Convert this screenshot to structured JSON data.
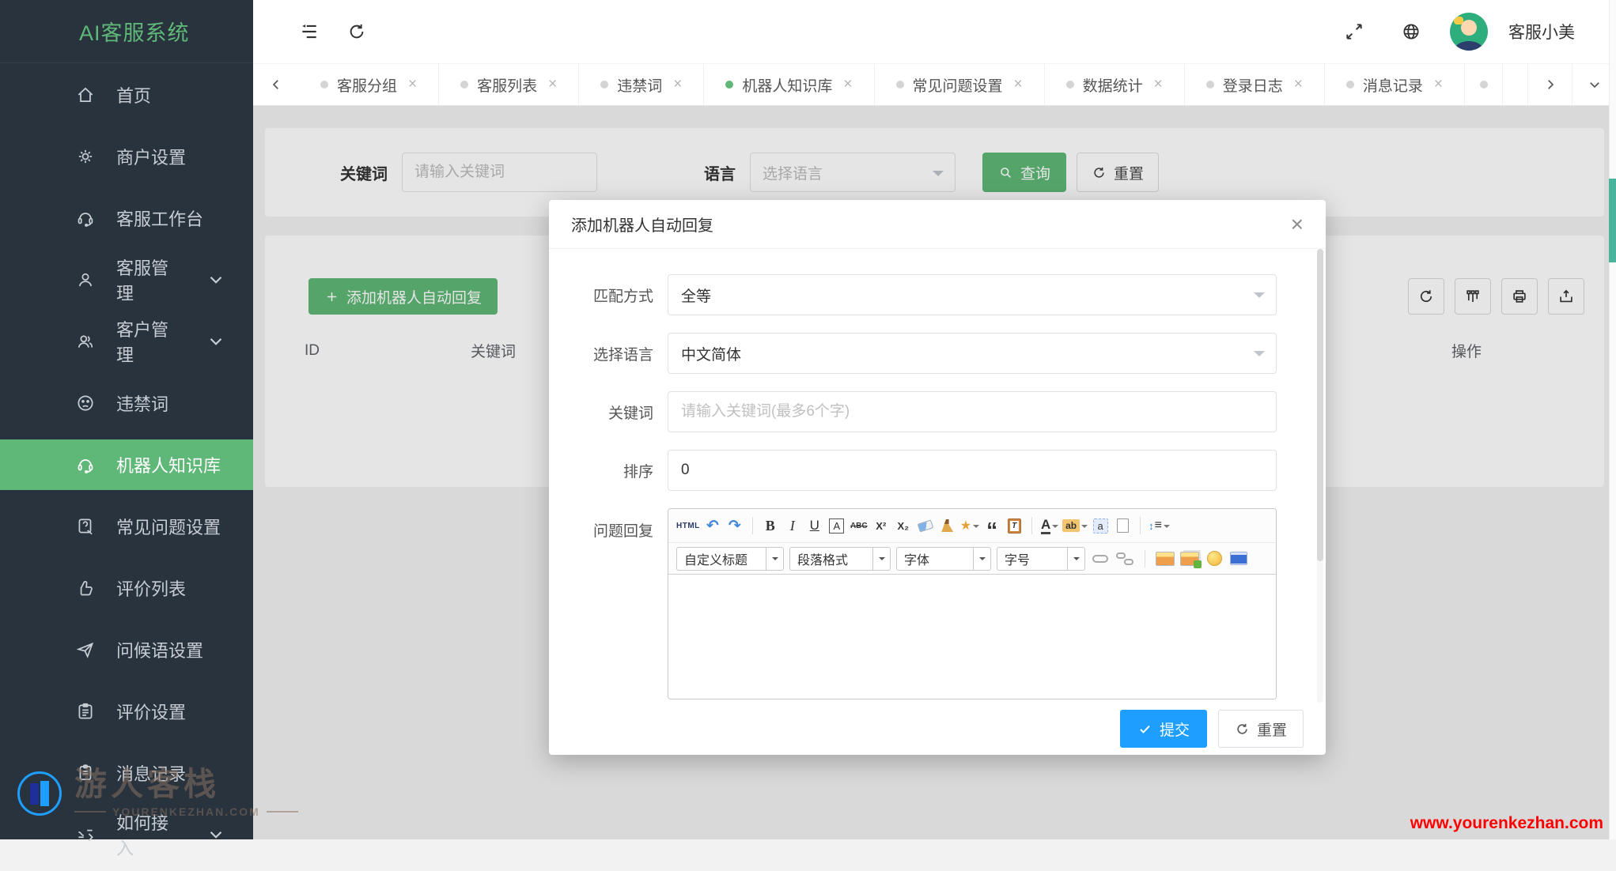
{
  "app": {
    "title": "AI客服系统",
    "user_name": "客服小美"
  },
  "sidebar": {
    "items": [
      {
        "label": "首页"
      },
      {
        "label": "商户设置"
      },
      {
        "label": "客服工作台"
      },
      {
        "label": "客服管理"
      },
      {
        "label": "客户管理"
      },
      {
        "label": "违禁词"
      },
      {
        "label": "机器人知识库"
      },
      {
        "label": "常见问题设置"
      },
      {
        "label": "评价列表"
      },
      {
        "label": "问候语设置"
      },
      {
        "label": "评价设置"
      },
      {
        "label": "消息记录"
      },
      {
        "label": "如何接入"
      }
    ],
    "watermark": {
      "name": "游人客栈",
      "domain": "YOURENKEZHAN.COM"
    }
  },
  "tabs": [
    "客服分组",
    "客服列表",
    "违禁词",
    "机器人知识库",
    "常见问题设置",
    "数据统计",
    "登录日志",
    "消息记录"
  ],
  "filter": {
    "keyword_label": "关键词",
    "keyword_placeholder": "请输入关键词",
    "language_label": "语言",
    "language_placeholder": "选择语言",
    "search_button": "查询",
    "reset_button": "重置"
  },
  "list": {
    "add_button": "添加机器人自动回复",
    "columns": {
      "id": "ID",
      "keyword": "关键词",
      "action": "操作"
    }
  },
  "modal": {
    "title": "添加机器人自动回复",
    "match_label": "匹配方式",
    "match_value": "全等",
    "language_label": "选择语言",
    "language_value": "中文简体",
    "keyword_label": "关键词",
    "keyword_placeholder": "请输入关键词(最多6个字)",
    "sort_label": "排序",
    "sort_value": "0",
    "reply_label": "问题回复",
    "editor": {
      "selects": [
        "自定义标题",
        "段落格式",
        "字体",
        "字号"
      ],
      "glyphs": {
        "html": "HTML",
        "undo": "↶",
        "redo": "↷",
        "bold": "B",
        "italic": "I",
        "underline": "U",
        "font_border": "A",
        "strikethrough": "ABC",
        "superscript": "X²",
        "subscript": "X₂",
        "wand": "★",
        "quote": "“",
        "paste_t": "T",
        "font_color": "A",
        "highlight": "ab",
        "anchor": "a",
        "updown": "↕",
        "lines": "≡"
      }
    },
    "submit_button": "提交",
    "reset_button": "重置"
  },
  "page": {
    "site_url": "www.yourenkezhan.com"
  },
  "colors": {
    "green": "#5FB878",
    "blue": "#1E9FFF",
    "sidebar_bg": "#28333E",
    "watermark_red": "#FF0000"
  }
}
